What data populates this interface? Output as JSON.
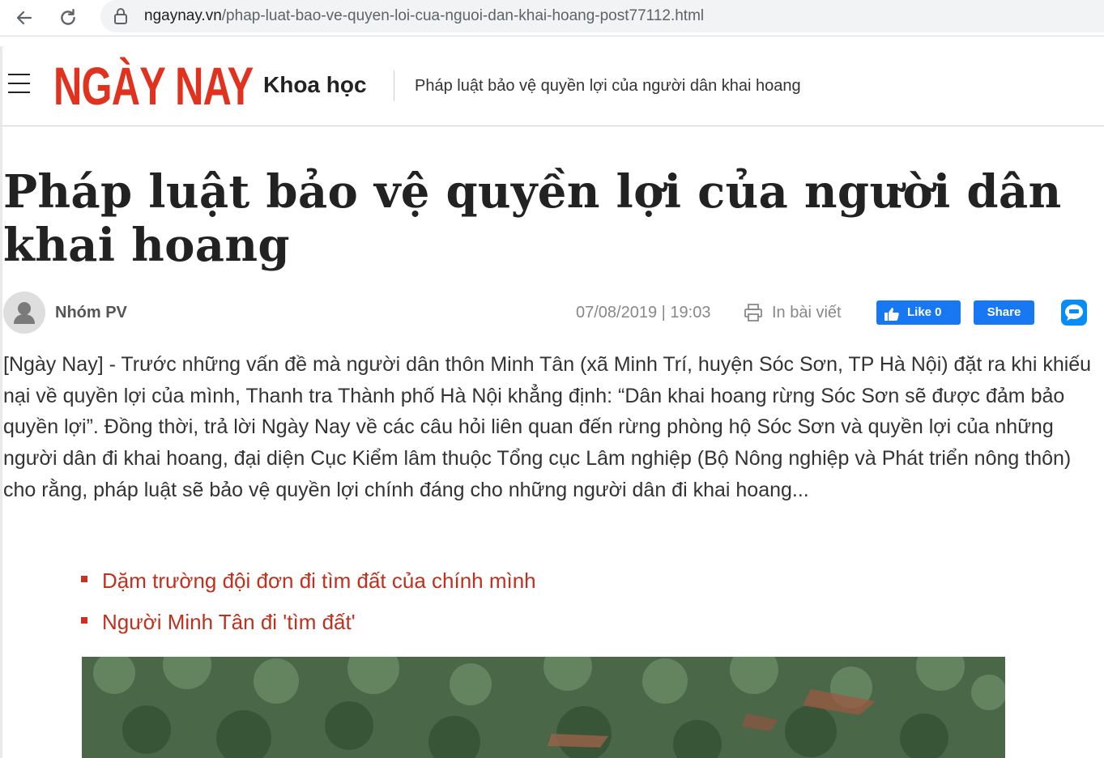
{
  "browser": {
    "url_host": "ngaynay.vn",
    "url_path": "/phap-luat-bao-ve-quyen-loi-cua-nguoi-dan-khai-hoang-post77112.html"
  },
  "header": {
    "logo_text": "NGÀY NAY",
    "section": "Khoa học",
    "article_title": "Pháp luật bảo vệ quyền lợi của người dân khai hoang"
  },
  "article": {
    "title": "Pháp luật bảo vệ quyền lợi của người dân khai hoang",
    "author": "Nhóm PV",
    "datetime": "07/08/2019 | 19:03",
    "print_label": "In bài viết",
    "like_label": "Like 0",
    "share_label": "Share",
    "sapo": "[Ngày Nay] - Trước những vấn đề mà người dân thôn Minh Tân (xã Minh Trí, huyện Sóc Sơn, TP Hà Nội) đặt ra khi khiếu nại về quyền lợi của mình, Thanh tra Thành phố Hà Nội khẳng định: “Dân khai hoang rừng Sóc Sơn sẽ được đảm bảo quyền lợi”. Đồng thời, trả lời Ngày Nay về các câu hỏi liên quan đến rừng phòng hộ Sóc Sơn và quyền lợi của những người dân đi khai hoang, đại diện Cục Kiểm lâm thuộc Tổng cục Lâm nghiệp (Bộ Nông nghiệp và Phát triển nông thôn) cho rằng, pháp luật sẽ bảo vệ quyền lợi chính đáng cho những người dân đi khai hoang...",
    "related": [
      "Dặm trường đội đơn đi tìm đất của chính mình",
      "Người Minh Tân đi 'tìm đất'"
    ]
  },
  "colors": {
    "brand_red": "#e0321f",
    "link_red": "#c0301c",
    "facebook_blue": "#1877f2",
    "zalo_blue": "#0a8cf5"
  },
  "icons": [
    "back-arrow-icon",
    "reload-icon",
    "lock-icon",
    "hamburger-menu-icon",
    "user-avatar-icon",
    "printer-icon",
    "thumbs-up-icon",
    "zalo-icon"
  ]
}
